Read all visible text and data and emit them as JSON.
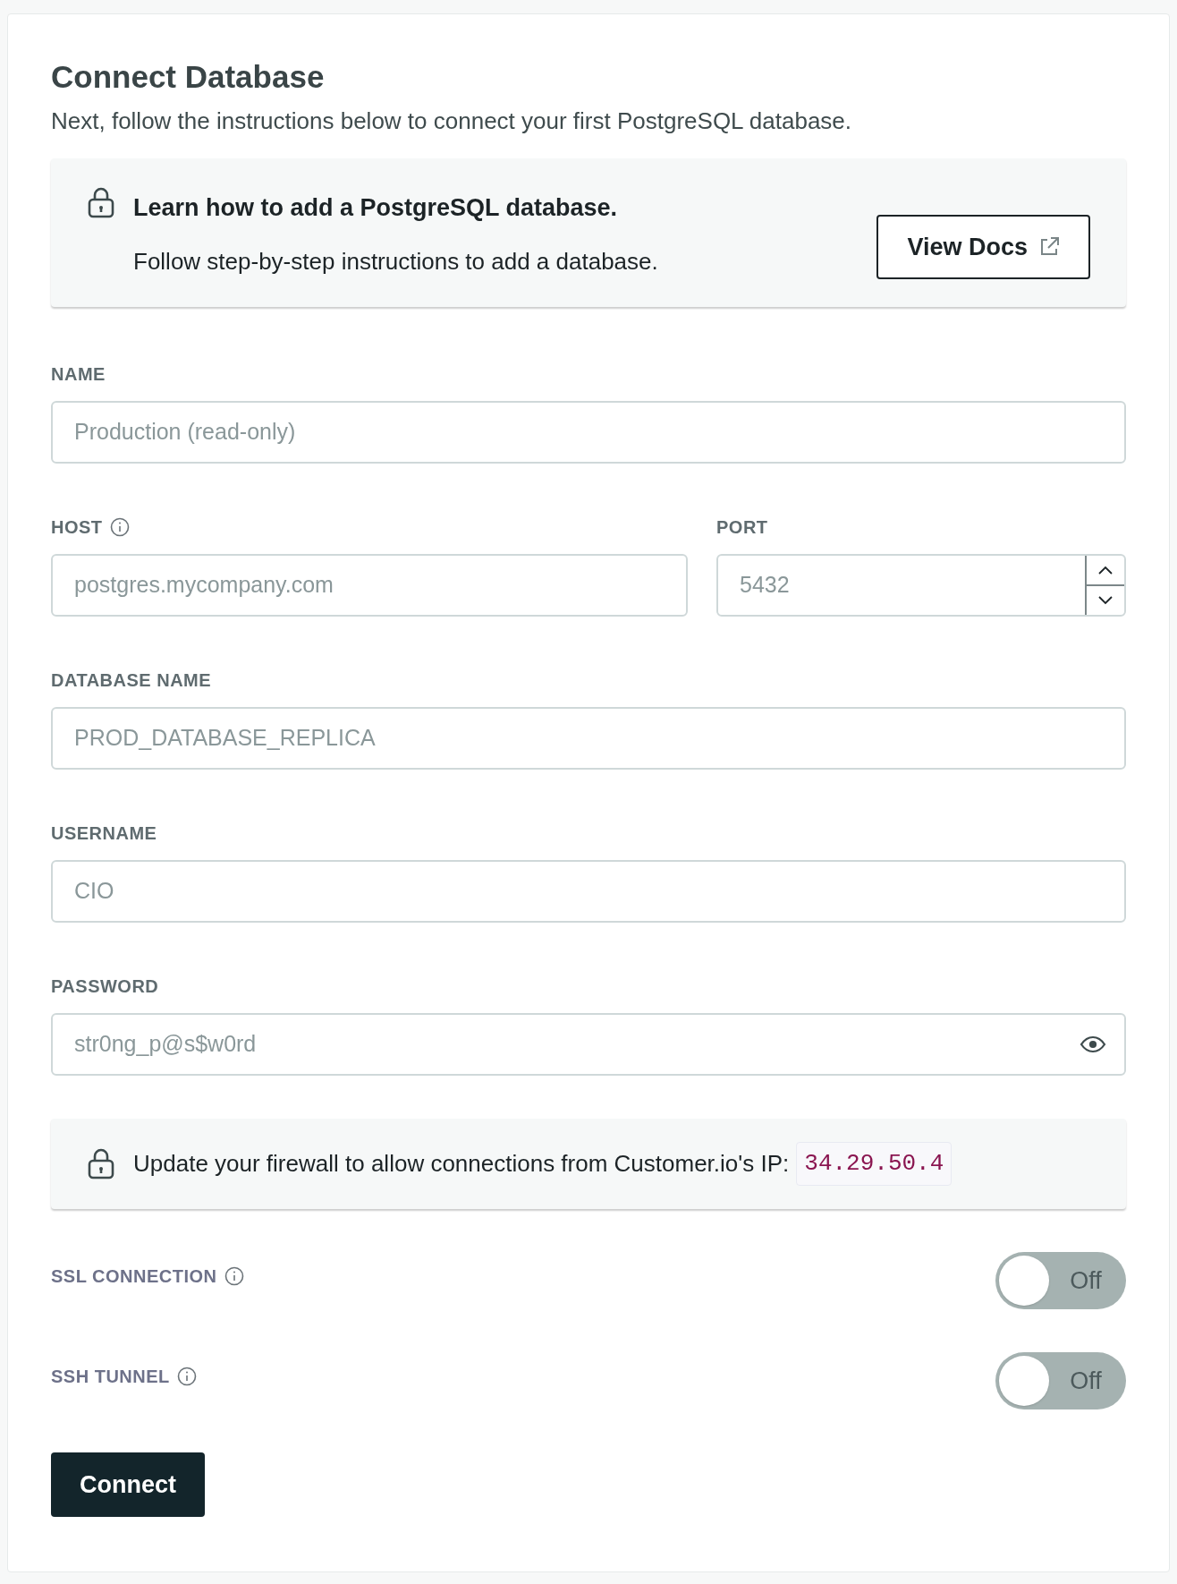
{
  "title": "Connect Database",
  "subtitle": "Next, follow the instructions below to connect your first PostgreSQL database.",
  "docs_card": {
    "heading": "Learn how to add a PostgreSQL database.",
    "text": "Follow step-by-step instructions to add a database.",
    "button": "View Docs"
  },
  "fields": [
    {
      "kind": "text",
      "label": "NAME",
      "placeholder": "Production (read-only)",
      "info": false
    },
    {
      "kind": "text",
      "label": "HOST",
      "placeholder": "postgres.mycompany.com",
      "info": true
    },
    {
      "kind": "number",
      "label": "PORT",
      "placeholder": "5432",
      "info": false
    },
    {
      "kind": "text",
      "label": "DATABASE NAME",
      "placeholder": "PROD_DATABASE_REPLICA",
      "info": false
    },
    {
      "kind": "text",
      "label": "USERNAME",
      "placeholder": "CIO",
      "info": false
    },
    {
      "kind": "password",
      "label": "PASSWORD",
      "placeholder": "str0ng_p@s$w0rd",
      "info": false
    }
  ],
  "firewall_note": {
    "text": "Update your firewall to allow connections from Customer.io's IP:",
    "ip": "34.29.50.4"
  },
  "toggles": [
    {
      "label": "SSL CONNECTION",
      "on": false,
      "state_text": "Off"
    },
    {
      "label": "SSH TUNNEL",
      "on": false,
      "state_text": "Off"
    }
  ],
  "submit": "Connect"
}
